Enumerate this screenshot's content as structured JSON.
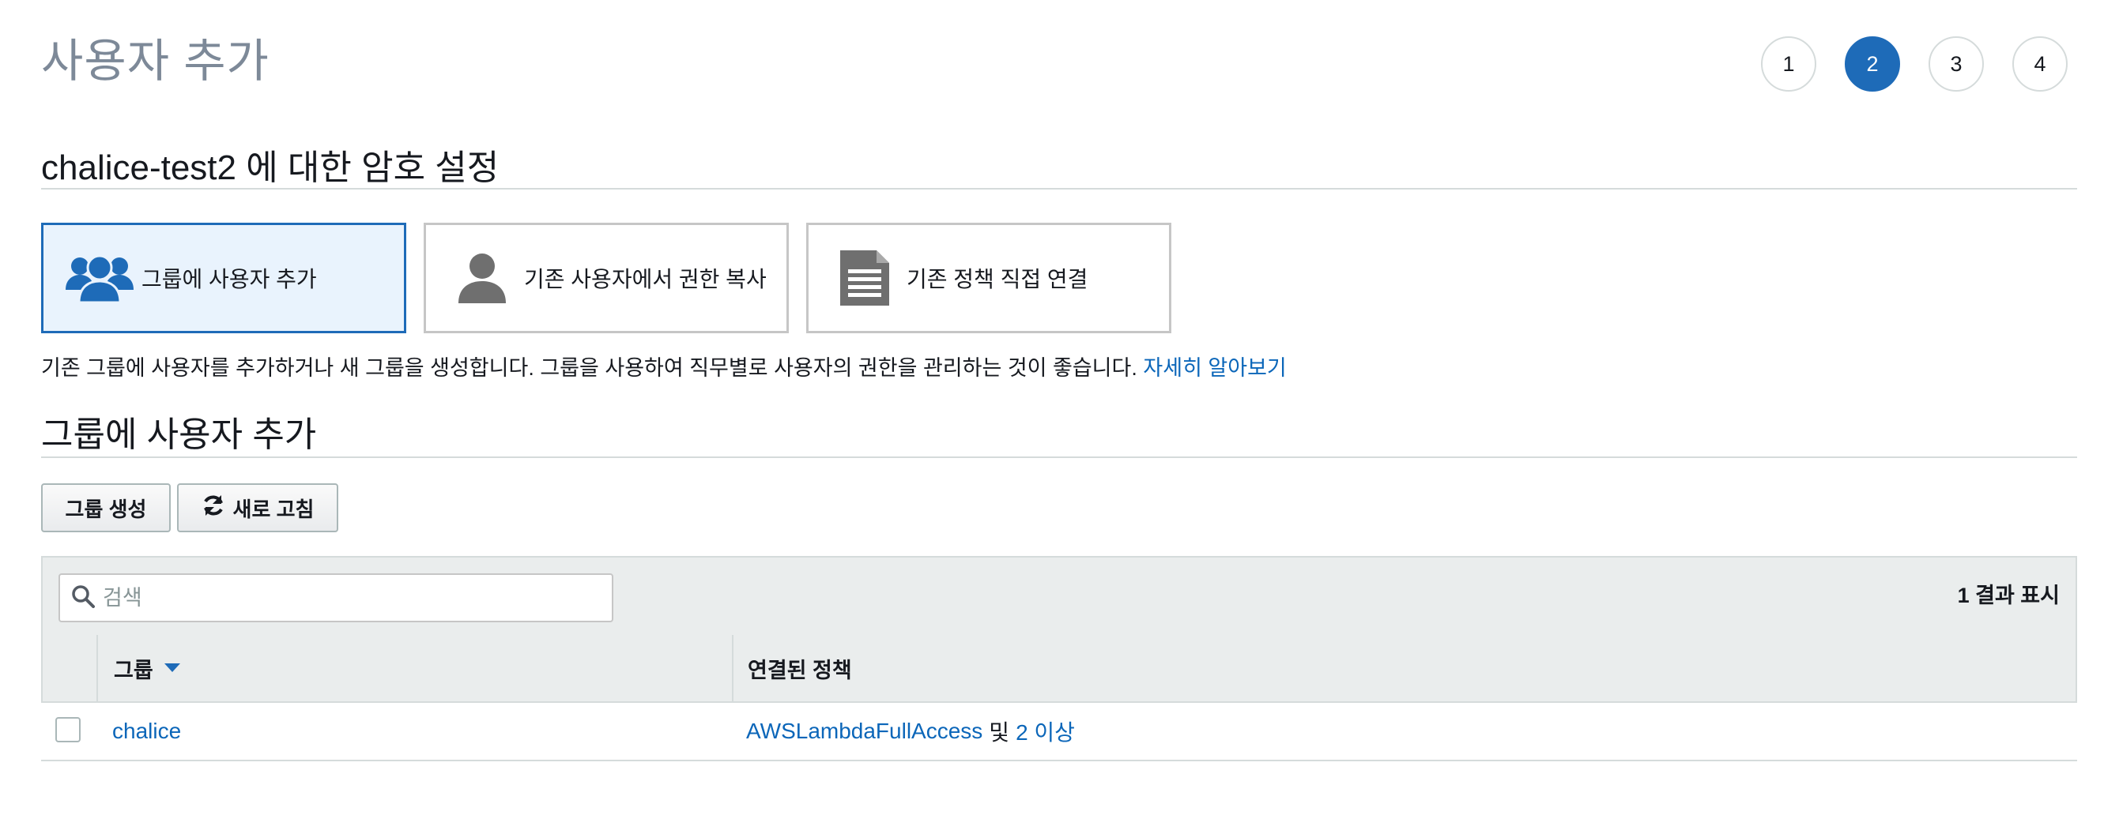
{
  "page": {
    "title": "사용자 추가"
  },
  "steps": [
    "1",
    "2",
    "3",
    "4"
  ],
  "permissions": {
    "title": "chalice-test2 에 대한 암호 설정",
    "options": [
      {
        "label": "그룹에 사용자 추가",
        "icon": "users-group-icon"
      },
      {
        "label": "기존 사용자에서 권한 복사",
        "icon": "user-icon"
      },
      {
        "label": "기존 정책 직접 연결",
        "icon": "document-icon"
      }
    ],
    "description": "기존 그룹에 사용자를 추가하거나 새 그룹을 생성합니다. 그룹을 사용하여 직무별로 사용자의 권한을 관리하는 것이 좋습니다.",
    "learn_more": "자세히 알아보기"
  },
  "group_section": {
    "title": "그룹에 사용자 추가",
    "create_button": "그룹 생성",
    "refresh_button": "새로 고침"
  },
  "table": {
    "search_placeholder": "검색",
    "result_count": "1 결과 표시",
    "columns": {
      "group": "그룹",
      "policies": "연결된 정책"
    },
    "rows": [
      {
        "group": "chalice",
        "policy": "AWSLambdaFullAccess",
        "and": "및",
        "more": "2 이상"
      }
    ]
  },
  "colors": {
    "accent": "#1e6bb8",
    "link": "#0b66b9"
  }
}
